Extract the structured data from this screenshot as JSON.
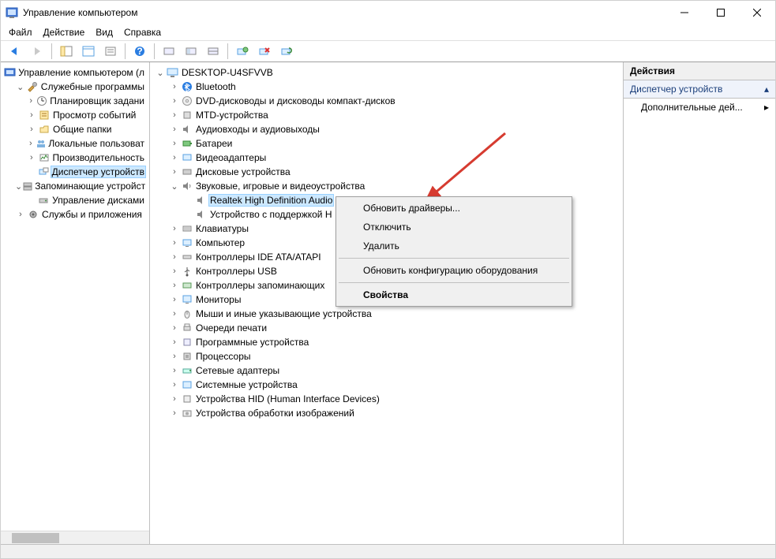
{
  "window": {
    "title": "Управление компьютером"
  },
  "menubar": {
    "file": "Файл",
    "action": "Действие",
    "view": "Вид",
    "help": "Справка"
  },
  "left_tree": {
    "root": "Управление компьютером (л",
    "group1": "Служебные программы",
    "item_scheduler": "Планировщик задани",
    "item_events": "Просмотр событий",
    "item_shared": "Общие папки",
    "item_users": "Локальные пользоват",
    "item_perf": "Производительность",
    "item_devmgr": "Диспетчер устройств",
    "group2": "Запоминающие устройст",
    "item_disks": "Управление дисками",
    "group3": "Службы и приложения"
  },
  "center_tree": {
    "root": "DESKTOP-U4SFVVB",
    "bluetooth": "Bluetooth",
    "dvd": "DVD-дисководы и дисководы компакт-дисков",
    "mtd": "MTD-устройства",
    "audio_io": "Аудиовходы и аудиовыходы",
    "batteries": "Батареи",
    "video": "Видеоадаптеры",
    "disks": "Дисковые устройства",
    "sound": "Звуковые, игровые и видеоустройства",
    "sound_realtek": "Realtek High Definition Audio",
    "sound_hd": "Устройство с поддержкой H",
    "keyboards": "Клавиатуры",
    "computer": "Компьютер",
    "ide": "Контроллеры IDE ATA/ATAPI",
    "usb": "Контроллеры USB",
    "storage_ctrl": "Контроллеры запоминающих",
    "monitors": "Мониторы",
    "mice": "Мыши и иные указывающие устройства",
    "print_queues": "Очереди печати",
    "software_dev": "Программные устройства",
    "processors": "Процессоры",
    "network": "Сетевые адаптеры",
    "system_dev": "Системные устройства",
    "hid": "Устройства HID (Human Interface Devices)",
    "imaging": "Устройства обработки изображений"
  },
  "context_menu": {
    "update": "Обновить драйверы...",
    "disable": "Отключить",
    "delete": "Удалить",
    "scan": "Обновить конфигурацию оборудования",
    "properties": "Свойства"
  },
  "actions": {
    "header": "Действия",
    "section": "Диспетчер устройств",
    "more": "Дополнительные дей..."
  }
}
